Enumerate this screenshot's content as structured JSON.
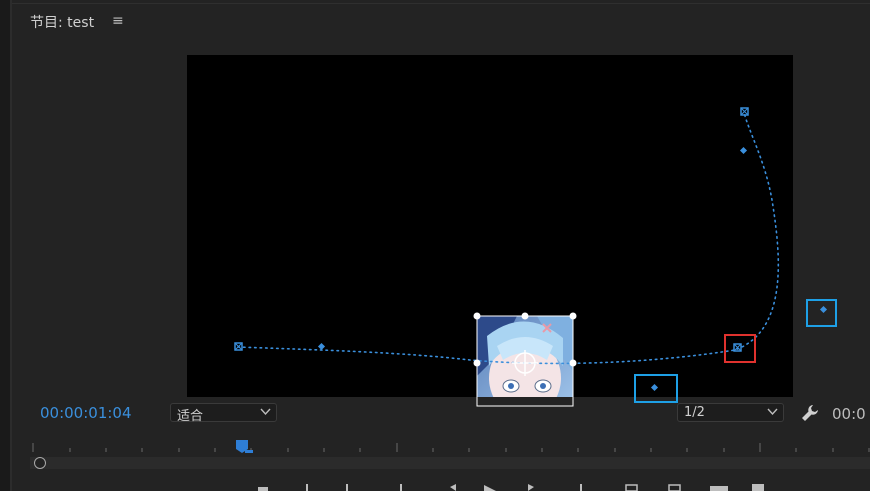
{
  "header": {
    "title": "节目: test",
    "menu_icon": "hamburger-menu-icon"
  },
  "viewer": {
    "background": "#000000",
    "path_color": "#3a8fdc",
    "highlight_red": "#e0322e",
    "highlight_blue": "#1ea0e6"
  },
  "bottom_bar": {
    "timecode": "00:00:01:04",
    "timecode_color": "#3a8fdc",
    "fit_select": "适合",
    "resolution_select": "1/2",
    "timecode_right": "00:0",
    "settings_icon": "wrench-icon"
  },
  "transport": {
    "icons": [
      "marker-icon",
      "in-point-icon",
      "out-point-icon",
      "go-to-in-icon",
      "step-back-icon",
      "play-icon",
      "step-forward-icon",
      "go-to-out-icon",
      "lift-icon",
      "extract-icon",
      "export-frame-icon",
      "comparison-icon"
    ]
  }
}
